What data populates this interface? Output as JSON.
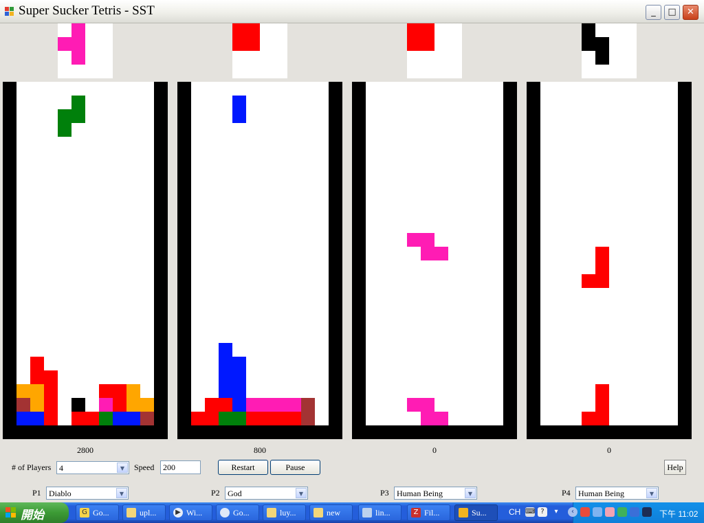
{
  "window": {
    "title": "Super Sucker Tetris - SST"
  },
  "colors": {
    "pink": "#ff1cb4",
    "red": "#ff0000",
    "green": "#00800b",
    "blue": "#0018ff",
    "orange": "#ffa600",
    "brown": "#a33333",
    "black": "#000000"
  },
  "boards": [
    {
      "score": "2800",
      "next_piece": [
        [
          "pink",
          1,
          0
        ],
        [
          "pink",
          0,
          1
        ],
        [
          "pink",
          1,
          1
        ],
        [
          "pink",
          1,
          2
        ]
      ],
      "cells": [
        [
          "green",
          4,
          1
        ],
        [
          "green",
          3,
          2
        ],
        [
          "green",
          4,
          2
        ],
        [
          "green",
          3,
          3
        ],
        [
          "red",
          1,
          20
        ],
        [
          "red",
          1,
          21
        ],
        [
          "red",
          2,
          21
        ],
        [
          "orange",
          0,
          22
        ],
        [
          "orange",
          1,
          22
        ],
        [
          "red",
          2,
          22
        ],
        [
          "red",
          6,
          22
        ],
        [
          "red",
          7,
          22
        ],
        [
          "orange",
          8,
          22
        ],
        [
          "brown",
          0,
          23
        ],
        [
          "orange",
          1,
          23
        ],
        [
          "red",
          2,
          23
        ],
        [
          "black",
          4,
          23
        ],
        [
          "pink",
          6,
          23
        ],
        [
          "red",
          7,
          23
        ],
        [
          "orange",
          8,
          23
        ],
        [
          "orange",
          9,
          23
        ],
        [
          "blue",
          0,
          24
        ],
        [
          "blue",
          1,
          24
        ],
        [
          "red",
          2,
          24
        ],
        [
          "red",
          4,
          24
        ],
        [
          "red",
          5,
          24
        ],
        [
          "green",
          6,
          24
        ],
        [
          "blue",
          7,
          24
        ],
        [
          "blue",
          8,
          24
        ],
        [
          "brown",
          9,
          24
        ]
      ]
    },
    {
      "score": "800",
      "next_piece": [
        [
          "red",
          0,
          0
        ],
        [
          "red",
          1,
          0
        ],
        [
          "red",
          0,
          1
        ],
        [
          "red",
          1,
          1
        ]
      ],
      "cells": [
        [
          "blue",
          3,
          1
        ],
        [
          "blue",
          3,
          2
        ],
        [
          "blue",
          2,
          19
        ],
        [
          "blue",
          2,
          20
        ],
        [
          "blue",
          3,
          20
        ],
        [
          "blue",
          2,
          21
        ],
        [
          "blue",
          3,
          21
        ],
        [
          "blue",
          2,
          22
        ],
        [
          "blue",
          3,
          22
        ],
        [
          "red",
          1,
          23
        ],
        [
          "red",
          2,
          23
        ],
        [
          "blue",
          3,
          23
        ],
        [
          "pink",
          4,
          23
        ],
        [
          "pink",
          5,
          23
        ],
        [
          "pink",
          6,
          23
        ],
        [
          "pink",
          7,
          23
        ],
        [
          "brown",
          8,
          23
        ],
        [
          "red",
          0,
          24
        ],
        [
          "red",
          1,
          24
        ],
        [
          "green",
          2,
          24
        ],
        [
          "green",
          3,
          24
        ],
        [
          "red",
          4,
          24
        ],
        [
          "red",
          5,
          24
        ],
        [
          "red",
          6,
          24
        ],
        [
          "red",
          7,
          24
        ],
        [
          "brown",
          8,
          24
        ]
      ]
    },
    {
      "score": "0",
      "next_piece": [
        [
          "red",
          0,
          0
        ],
        [
          "red",
          1,
          0
        ],
        [
          "red",
          0,
          1
        ],
        [
          "red",
          1,
          1
        ]
      ],
      "cells": [
        [
          "pink",
          3,
          11
        ],
        [
          "pink",
          4,
          11
        ],
        [
          "pink",
          4,
          12
        ],
        [
          "pink",
          5,
          12
        ],
        [
          "pink",
          3,
          23
        ],
        [
          "pink",
          4,
          23
        ],
        [
          "pink",
          4,
          24
        ],
        [
          "pink",
          5,
          24
        ]
      ]
    },
    {
      "score": "0",
      "next_piece": [
        [
          "black",
          0,
          0
        ],
        [
          "black",
          0,
          1
        ],
        [
          "black",
          1,
          1
        ],
        [
          "black",
          1,
          2
        ]
      ],
      "cells": [
        [
          "red",
          4,
          12
        ],
        [
          "red",
          4,
          13
        ],
        [
          "red",
          3,
          14
        ],
        [
          "red",
          4,
          14
        ],
        [
          "red",
          4,
          22
        ],
        [
          "red",
          4,
          23
        ],
        [
          "red",
          3,
          24
        ],
        [
          "red",
          4,
          24
        ]
      ]
    }
  ],
  "controls": {
    "players_label": "# of Players",
    "players_value": "4",
    "speed_label": "Speed",
    "speed_value": "200",
    "restart_label": "Restart",
    "pause_label": "Pause",
    "help_label": "Help"
  },
  "players": [
    {
      "label": "P1",
      "type": "Diablo"
    },
    {
      "label": "P2",
      "type": "God"
    },
    {
      "label": "P3",
      "type": "Human Being"
    },
    {
      "label": "P4",
      "type": "Human Being"
    }
  ],
  "taskbar": {
    "start_label": "開始",
    "tasks": [
      {
        "label": "Go...",
        "icon": "search-icon"
      },
      {
        "label": "upl...",
        "icon": "folder-icon"
      },
      {
        "label": "Wi...",
        "icon": "media-player-icon"
      },
      {
        "label": "Go...",
        "icon": "chat-icon"
      },
      {
        "label": "luy...",
        "icon": "folder-icon"
      },
      {
        "label": "new",
        "icon": "folder-icon"
      },
      {
        "label": "lin...",
        "icon": "network-icon"
      },
      {
        "label": "Fil...",
        "icon": "filezilla-icon"
      },
      {
        "label": "Su...",
        "icon": "tetris-app-icon"
      }
    ],
    "language": "CH",
    "clock": "下午 11:02"
  }
}
